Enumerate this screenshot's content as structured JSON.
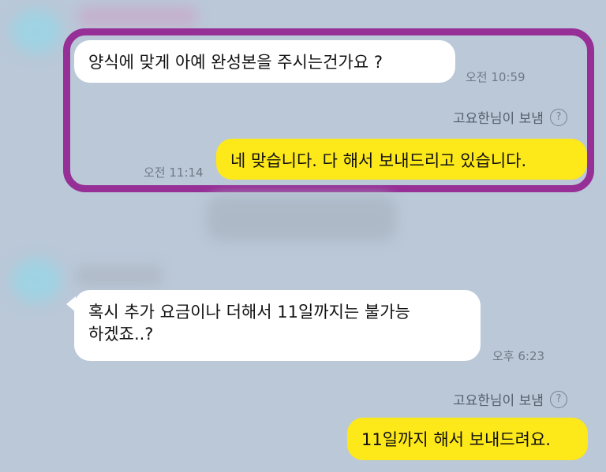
{
  "messages": [
    {
      "id": "m1",
      "text": "양식에 맞게 아예 완성본을 주시는건가요 ?",
      "time": "오전 10:59"
    },
    {
      "id": "m2",
      "sender_note": "고요한님이 보냄",
      "text": "네 맞습니다. 다 해서 보내드리고 있습니다.",
      "time": "오전 11:14"
    },
    {
      "id": "m3",
      "text": "혹시 추가 요금이나 더해서 11일까지는 불가능\n하겠죠..?",
      "time": "오후 6:23"
    },
    {
      "id": "m4",
      "sender_note": "고요한님이 보냄",
      "text": "11일까지 해서 보내드려요."
    }
  ],
  "icons": {
    "help": "question-circle-icon",
    "help_glyph": "?"
  },
  "colors": {
    "background": "#bac8d8",
    "highlight": "#962f96",
    "my_bubble": "#fde81a",
    "their_bubble": "#ffffff"
  }
}
